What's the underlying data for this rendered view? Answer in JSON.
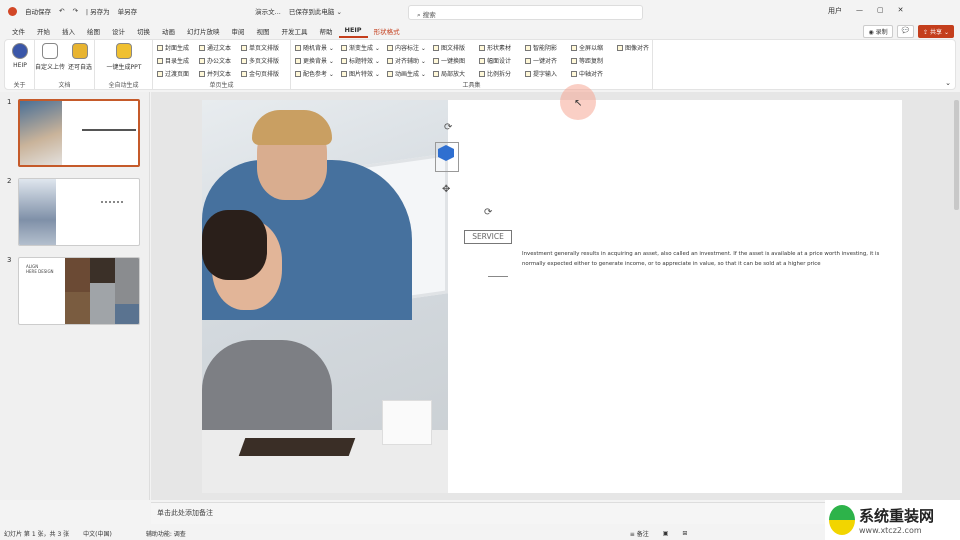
{
  "titlebar": {
    "quick_access": [
      "自动保存",
      "○",
      "↶",
      "↷"
    ],
    "autosave": "| 另存为",
    "save_format": "单另存",
    "doc_name": "演示文...",
    "save_status": "已保存到此电脑 ⌄",
    "search_placeholder": "搜索",
    "user": "用户",
    "window": [
      "—",
      "▢",
      "✕"
    ]
  },
  "tabs": [
    {
      "label": "文件"
    },
    {
      "label": "开始"
    },
    {
      "label": "插入"
    },
    {
      "label": "绘图"
    },
    {
      "label": "设计"
    },
    {
      "label": "切换"
    },
    {
      "label": "动画"
    },
    {
      "label": "幻灯片放映"
    },
    {
      "label": "审阅"
    },
    {
      "label": "视图"
    },
    {
      "label": "开发工具"
    },
    {
      "label": "帮助"
    },
    {
      "label": "HEIP",
      "active": true
    },
    {
      "label": "形状格式",
      "contextual": true
    }
  ],
  "right_buttons": {
    "record": "◉ 录制",
    "comment": "💬",
    "share": "⇪ 共享 ⌄"
  },
  "ribbon": {
    "groups": [
      {
        "label": "关于",
        "big": [
          {
            "label": "HEIP",
            "icon": "heip-logo-icon"
          }
        ]
      },
      {
        "label": "文档",
        "big": [
          {
            "label": "自定义上传",
            "icon": "cloud-icon"
          },
          {
            "label": "还可自选",
            "icon": "jar-icon"
          }
        ]
      },
      {
        "label": "全自动生成",
        "big": [
          {
            "label": "一键生成PPT",
            "icon": "ppt-icon"
          }
        ]
      },
      {
        "label": "单页生成",
        "items": [
          "封面生成",
          "目录生成",
          "过渡页面",
          "通过文本",
          "办公文本",
          "并列文本",
          "单页文排版",
          "多页文排版",
          "金句页排版"
        ]
      },
      {
        "label": "工具集",
        "items": [
          "随机背景 ⌄",
          "更换背景 ⌄",
          "配色参考 ⌄",
          "渐变生成 ⌄",
          "标题特效 ⌄",
          "图片特效 ⌄",
          "内容标注 ⌄",
          "对齐辅助 ⌄",
          "动画生成 ⌄",
          "图文排版",
          "一键换图",
          "局部放大",
          "形状素材",
          "幅面设计",
          "比例拆分",
          "智能阴影",
          "一键对齐",
          "提字输入",
          "全屏以缩",
          "等距复制",
          "中轴对齐",
          "图像对齐"
        ]
      }
    ]
  },
  "thumbnails": [
    {
      "number": "1",
      "selected": true
    },
    {
      "number": "2"
    },
    {
      "number": "3",
      "title": "ALIGN\nHERE DESIGN"
    }
  ],
  "slide": {
    "service_label": "SERVICE",
    "body": "Investment generally results in acquiring an asset, also called an investment. If the asset is available at a price worth investing, it is normally expected either to generate income, or to appreciate in value, so that it can be sold at a higher price"
  },
  "notes": {
    "placeholder": "单击此处添加备注"
  },
  "status": {
    "slide_info": "幻灯片 第 1 张，共 3 张",
    "language": "中文(中国)",
    "accessibility": "辅助功能: 调查",
    "notes_btn": "≡ 备注",
    "views": [
      "▣",
      "⊞"
    ]
  },
  "watermark": {
    "brand": "系统重装网",
    "url": "www.xtcz2.com"
  },
  "colors": {
    "accent": "#c43e1c",
    "selection": "#c55a2a",
    "icon_blue": "#2f6fd0"
  }
}
